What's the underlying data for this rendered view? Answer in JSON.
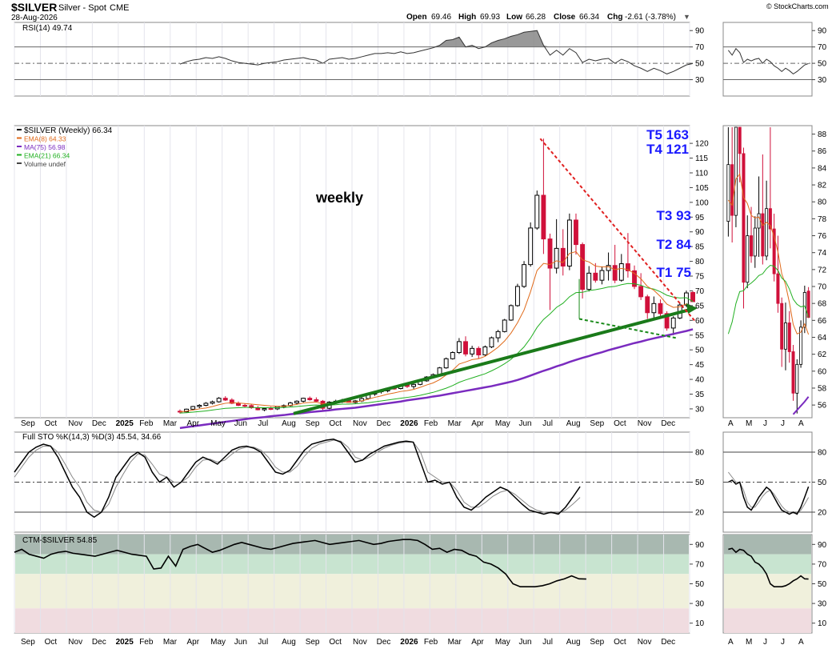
{
  "header": {
    "symbol": "$SILVER",
    "name": "Silver - Spot",
    "exchange": "CME",
    "date": "28-Aug-2026",
    "copyright": "© StockCharts.com",
    "open_label": "Open",
    "open": "69.46",
    "high_label": "High",
    "high": "69.93",
    "low_label": "Low",
    "low": "66.28",
    "close_label": "Close",
    "close": "66.34",
    "chg_label": "Chg",
    "chg": "-2.61 (-3.78%)"
  },
  "rsi": {
    "label": "RSI(14) 49.74",
    "ticks": [
      "90",
      "70",
      "50",
      "30"
    ],
    "right_ticks": [
      "90",
      "70",
      "50",
      "30"
    ]
  },
  "price": {
    "legend": [
      "$SILVER (Weekly) 66.34",
      "EMA(8) 64.33",
      "MA(75) 56.98",
      "EMA(21) 66.34",
      "Volume undef"
    ],
    "legend_colors": [
      "#000000",
      "#e06a1a",
      "#7a2bbf",
      "#22b022",
      "#444444"
    ],
    "annotation_weekly": "weekly",
    "targets": [
      "T5 163",
      "T4 121",
      "T3 93",
      "T2 84",
      "T1 75"
    ],
    "ticks": [
      "120",
      "115",
      "110",
      "105",
      "100",
      "95",
      "90",
      "85",
      "80",
      "75",
      "70",
      "65",
      "60",
      "55",
      "50",
      "45",
      "40",
      "35",
      "30"
    ],
    "right_ticks": [
      "88",
      "86",
      "84",
      "82",
      "80",
      "78",
      "76",
      "74",
      "72",
      "70",
      "68",
      "66",
      "64",
      "62",
      "60",
      "58",
      "56"
    ]
  },
  "sto": {
    "label": "Full STO %K(14,3) %D(3) 45.54, 34.66",
    "ticks": [
      "80",
      "50",
      "20"
    ],
    "right_ticks": [
      "80",
      "50",
      "20"
    ]
  },
  "ctm": {
    "label": "CTM-$SILVER 54.85",
    "ticks": [
      "90",
      "70",
      "50",
      "30",
      "10"
    ],
    "right_ticks": [
      "90",
      "70",
      "50",
      "30",
      "10"
    ]
  },
  "x_axis": {
    "labels": [
      "Sep",
      "Oct",
      "Nov",
      "Dec",
      "2025",
      "Feb",
      "Mar",
      "Apr",
      "May",
      "Jun",
      "Jul",
      "Aug",
      "Sep",
      "Oct",
      "Nov",
      "Dec",
      "2026",
      "Feb",
      "Mar",
      "Apr",
      "May",
      "Jun",
      "Jul",
      "Aug",
      "Sep",
      "Oct",
      "Nov",
      "Dec"
    ],
    "right_labels": [
      "A",
      "M",
      "J",
      "J",
      "A"
    ]
  },
  "chart_data": {
    "type": "candlestick",
    "title": "$SILVER Silver - Spot CME (Weekly)",
    "series": [
      {
        "name": "$SILVER (Weekly) 66.34",
        "ohlc": [
          [
            29.2,
            29.8,
            28.4,
            29.0
          ],
          [
            29.0,
            30.1,
            28.8,
            29.9
          ],
          [
            29.9,
            31.0,
            29.5,
            30.8
          ],
          [
            30.8,
            31.6,
            30.2,
            31.2
          ],
          [
            31.2,
            32.3,
            30.9,
            31.9
          ],
          [
            31.9,
            32.8,
            31.5,
            32.4
          ],
          [
            32.4,
            34.0,
            32.1,
            33.6
          ],
          [
            33.6,
            34.3,
            32.7,
            33.0
          ],
          [
            33.0,
            33.6,
            31.6,
            31.9
          ],
          [
            31.9,
            32.5,
            30.9,
            31.2
          ],
          [
            31.2,
            31.8,
            30.5,
            31.1
          ],
          [
            31.1,
            31.6,
            30.0,
            30.4
          ],
          [
            30.4,
            31.0,
            29.5,
            29.7
          ],
          [
            29.7,
            30.5,
            29.2,
            30.1
          ],
          [
            30.1,
            30.7,
            29.6,
            30.0
          ],
          [
            30.0,
            30.9,
            29.6,
            30.8
          ],
          [
            30.8,
            31.5,
            30.2,
            31.1
          ],
          [
            31.1,
            32.4,
            30.8,
            32.0
          ],
          [
            32.0,
            32.9,
            31.4,
            32.6
          ],
          [
            32.6,
            33.8,
            32.2,
            33.6
          ],
          [
            33.6,
            34.2,
            32.8,
            33.1
          ],
          [
            33.1,
            33.9,
            32.4,
            32.6
          ],
          [
            32.6,
            33.0,
            29.6,
            30.2
          ],
          [
            30.2,
            32.6,
            29.9,
            32.3
          ],
          [
            32.3,
            33.1,
            31.7,
            32.6
          ],
          [
            32.6,
            33.4,
            32.0,
            32.9
          ],
          [
            32.9,
            33.5,
            32.1,
            32.2
          ],
          [
            32.2,
            33.0,
            31.8,
            32.7
          ],
          [
            32.7,
            34.0,
            32.3,
            33.5
          ],
          [
            33.5,
            35.3,
            33.1,
            35.0
          ],
          [
            35.0,
            36.1,
            34.4,
            35.8
          ],
          [
            35.8,
            36.6,
            35.2,
            36.1
          ],
          [
            36.1,
            37.2,
            35.6,
            37.0
          ],
          [
            37.0,
            37.9,
            36.5,
            36.9
          ],
          [
            36.9,
            38.2,
            36.6,
            38.0
          ],
          [
            38.0,
            39.0,
            37.1,
            37.6
          ],
          [
            37.6,
            38.6,
            36.8,
            38.3
          ],
          [
            38.3,
            39.8,
            38.0,
            39.5
          ],
          [
            39.5,
            41.1,
            39.2,
            40.8
          ],
          [
            40.8,
            42.0,
            40.3,
            41.6
          ],
          [
            41.6,
            44.2,
            41.4,
            43.9
          ],
          [
            43.9,
            47.4,
            43.6,
            47.0
          ],
          [
            47.0,
            49.5,
            46.7,
            49.1
          ],
          [
            49.1,
            54.0,
            48.6,
            52.8
          ],
          [
            52.8,
            54.6,
            47.8,
            48.6
          ],
          [
            48.6,
            51.4,
            47.6,
            50.5
          ],
          [
            50.5,
            51.2,
            47.0,
            48.3
          ],
          [
            48.3,
            51.5,
            48.0,
            51.0
          ],
          [
            51.0,
            54.5,
            50.6,
            54.1
          ],
          [
            54.1,
            56.8,
            52.6,
            56.2
          ],
          [
            56.2,
            60.5,
            55.9,
            60.1
          ],
          [
            60.1,
            65.4,
            59.8,
            65.0
          ],
          [
            65.0,
            72.4,
            64.6,
            71.5
          ],
          [
            71.5,
            80.1,
            71.0,
            78.9
          ],
          [
            78.9,
            93.2,
            78.2,
            91.3
          ],
          [
            91.3,
            104.0,
            90.7,
            102.4
          ],
          [
            102.4,
            121.6,
            82.5,
            87.6
          ],
          [
            87.6,
            89.4,
            63.5,
            77.7
          ],
          [
            77.7,
            94.3,
            75.9,
            84.4
          ],
          [
            84.4,
            90.9,
            75.2,
            78.4
          ],
          [
            78.4,
            96.2,
            77.0,
            94.0
          ],
          [
            94.0,
            96.2,
            82.3,
            85.7
          ],
          [
            85.7,
            86.4,
            67.4,
            70.5
          ],
          [
            70.5,
            78.4,
            69.8,
            76.0
          ],
          [
            76.0,
            79.4,
            72.8,
            73.6
          ],
          [
            73.6,
            78.3,
            72.2,
            76.9
          ],
          [
            76.9,
            83.0,
            73.5,
            78.6
          ],
          [
            78.6,
            85.6,
            72.6,
            73.6
          ],
          [
            73.6,
            82.5,
            73.1,
            79.2
          ],
          [
            79.2,
            89.6,
            74.5,
            76.8
          ],
          [
            76.8,
            78.6,
            70.6,
            71.5
          ],
          [
            71.5,
            76.0,
            66.9,
            68.0
          ],
          [
            68.0,
            68.7,
            60.5,
            62.6
          ],
          [
            62.6,
            68.1,
            60.1,
            65.7
          ],
          [
            65.7,
            67.1,
            61.0,
            62.3
          ],
          [
            62.3,
            63.1,
            56.5,
            57.4
          ],
          [
            57.4,
            61.4,
            55.0,
            60.8
          ],
          [
            60.8,
            66.0,
            60.4,
            65.2
          ],
          [
            65.2,
            70.1,
            64.5,
            69.3
          ],
          [
            69.46,
            69.93,
            66.28,
            66.34
          ]
        ]
      },
      {
        "name": "EMA(8) 64.33",
        "values": [
          29.0,
          29.2,
          29.6,
          30.0,
          30.3,
          30.8,
          31.4,
          31.9,
          32.1,
          32.0,
          31.8,
          31.6,
          31.4,
          31.2,
          31.0,
          30.9,
          30.9,
          31.2,
          31.5,
          32.0,
          32.2,
          32.3,
          31.7,
          31.9,
          32.1,
          32.3,
          32.3,
          32.4,
          32.7,
          33.3,
          33.9,
          34.4,
          35.0,
          35.4,
          35.9,
          36.2,
          36.6,
          37.3,
          38.1,
          38.8,
          39.9,
          41.5,
          43.1,
          45.2,
          45.9,
          46.7,
          47.0,
          47.8,
          49.3,
          50.9,
          53.0,
          55.7,
          59.2,
          63.5,
          69.7,
          76.9,
          79.3,
          78.9,
          80.2,
          79.6,
          82.7,
          83.3,
          80.5,
          79.8,
          78.4,
          78.1,
          78.2,
          77.2,
          77.6,
          77.2,
          75.9,
          74.1,
          71.5,
          70.2,
          68.1,
          65.5,
          64.4,
          64.6,
          65.6,
          64.33
        ]
      },
      {
        "name": "MA(75) 56.98",
        "values": [
          23.5,
          23.8,
          24.1,
          24.4,
          24.7,
          25.0,
          25.3,
          25.6,
          25.9,
          26.2,
          26.5,
          26.8,
          27.0,
          27.2,
          27.5,
          27.7,
          27.9,
          28.2,
          28.4,
          28.6,
          28.9,
          29.1,
          29.3,
          29.5,
          29.8,
          30.0,
          30.2,
          30.4,
          30.7,
          31.0,
          31.3,
          31.6,
          31.9,
          32.2,
          32.5,
          32.9,
          33.2,
          33.5,
          33.8,
          34.2,
          34.5,
          34.9,
          35.3,
          35.7,
          36.1,
          36.5,
          36.9,
          37.3,
          37.7,
          38.2,
          38.7,
          39.2,
          39.8,
          40.5,
          41.3,
          42.1,
          42.9,
          43.6,
          44.4,
          45.1,
          45.9,
          46.6,
          47.3,
          47.9,
          48.6,
          49.2,
          49.9,
          50.5,
          51.1,
          51.7,
          52.3,
          52.8,
          53.4,
          53.9,
          54.4,
          54.9,
          55.4,
          55.9,
          56.4,
          56.98
        ]
      },
      {
        "name": "EMA(21) 66.34",
        "values": [
          28.6,
          28.7,
          28.9,
          29.1,
          29.3,
          29.6,
          29.9,
          30.2,
          30.3,
          30.4,
          30.5,
          30.5,
          30.4,
          30.4,
          30.4,
          30.4,
          30.5,
          30.6,
          30.8,
          31.0,
          31.2,
          31.3,
          31.2,
          31.3,
          31.4,
          31.6,
          31.6,
          31.7,
          31.9,
          32.1,
          32.4,
          32.7,
          33.0,
          33.3,
          33.6,
          33.9,
          34.2,
          34.6,
          35.1,
          35.6,
          36.3,
          37.0,
          37.9,
          39.0,
          39.8,
          40.5,
          41.2,
          41.9,
          42.9,
          44.0,
          45.3,
          46.8,
          48.8,
          51.0,
          54.0,
          57.6,
          60.3,
          62.2,
          64.4,
          65.8,
          68.0,
          69.4,
          69.5,
          70.1,
          70.4,
          70.8,
          71.3,
          71.5,
          72.1,
          72.5,
          72.4,
          71.9,
          71.0,
          70.6,
          69.7,
          68.5,
          67.9,
          67.6,
          67.7,
          66.34
        ]
      }
    ],
    "ylim": [
      27,
      126
    ],
    "trendlines": [
      {
        "name": "support uptrend",
        "from": [
          43,
          28.4
        ],
        "to": [
          104,
          63.6
        ]
      },
      {
        "name": "downtrend resistance",
        "from": [
          56,
          121.6
        ],
        "to": [
          80,
          59.3
        ]
      },
      {
        "name": "lower dotted",
        "from": [
          62,
          60.5
        ],
        "to": [
          77,
          54.0
        ]
      }
    ]
  },
  "rsi_data": {
    "ylim": [
      10,
      100
    ],
    "values": [
      49,
      52,
      54,
      55,
      57,
      56,
      58,
      56,
      53,
      51,
      50,
      49,
      48,
      50,
      51,
      52,
      54,
      55,
      56,
      57,
      55,
      54,
      50,
      55,
      56,
      57,
      55,
      56,
      58,
      60,
      62,
      62,
      63,
      62,
      64,
      62,
      63,
      65,
      67,
      69,
      72,
      78,
      79,
      82,
      70,
      72,
      68,
      70,
      75,
      78,
      80,
      83,
      85,
      88,
      89,
      90,
      72,
      60,
      66,
      60,
      68,
      63,
      51,
      55,
      53,
      55,
      56,
      50,
      55,
      52,
      47,
      44,
      40,
      44,
      41,
      37,
      40,
      44,
      48,
      49.74
    ]
  },
  "sto_data": {
    "ylim": [
      0,
      100
    ],
    "k": [
      60,
      70,
      80,
      85,
      88,
      86,
      75,
      60,
      45,
      35,
      20,
      15,
      20,
      35,
      55,
      65,
      75,
      80,
      75,
      60,
      50,
      55,
      45,
      50,
      60,
      70,
      75,
      72,
      68,
      75,
      82,
      85,
      86,
      84,
      80,
      70,
      60,
      58,
      62,
      72,
      82,
      88,
      90,
      92,
      93,
      90,
      80,
      70,
      72,
      78,
      82,
      86,
      88,
      90,
      91,
      90,
      70,
      50,
      52,
      48,
      50,
      35,
      25,
      22,
      28,
      35,
      40,
      45,
      42,
      35,
      28,
      22,
      20,
      18,
      20,
      18,
      25,
      35,
      45.54
    ],
    "d": [
      55,
      65,
      75,
      82,
      86,
      86,
      80,
      68,
      55,
      45,
      30,
      22,
      20,
      28,
      45,
      58,
      70,
      78,
      77,
      68,
      58,
      55,
      50,
      50,
      55,
      65,
      72,
      73,
      70,
      72,
      78,
      83,
      85,
      85,
      82,
      75,
      65,
      60,
      60,
      66,
      76,
      84,
      88,
      90,
      92,
      91,
      85,
      75,
      72,
      75,
      80,
      84,
      87,
      89,
      90,
      90,
      80,
      60,
      55,
      50,
      50,
      42,
      30,
      25,
      25,
      30,
      36,
      40,
      42,
      38,
      32,
      26,
      22,
      20,
      19,
      19,
      22,
      28,
      34.66
    ]
  },
  "ctm_data": {
    "ylim": [
      0,
      100
    ],
    "values": [
      82,
      85,
      80,
      78,
      76,
      80,
      82,
      83,
      81,
      80,
      79,
      78,
      80,
      82,
      84,
      82,
      80,
      79,
      78,
      65,
      66,
      78,
      68,
      85,
      88,
      90,
      86,
      82,
      84,
      87,
      90,
      92,
      90,
      88,
      86,
      85,
      87,
      89,
      91,
      92,
      93,
      94,
      92,
      90,
      91,
      92,
      93,
      94,
      92,
      90,
      91,
      93,
      94,
      95,
      95,
      94,
      90,
      85,
      86,
      82,
      85,
      84,
      80,
      78,
      72,
      70,
      66,
      60,
      50,
      47,
      47,
      47,
      48,
      50,
      53,
      55,
      58,
      55,
      54.85
    ]
  }
}
